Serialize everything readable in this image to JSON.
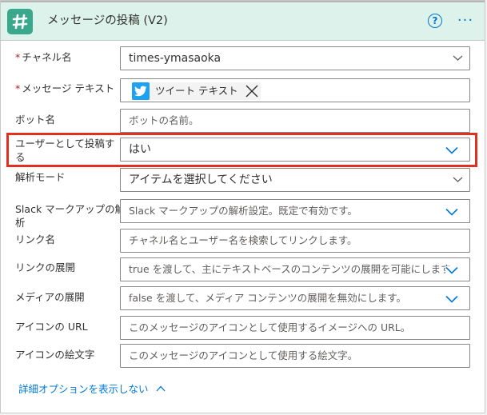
{
  "header": {
    "title": "メッセージの投稿 (V2)",
    "help_glyph": "?",
    "more_glyph": "···",
    "icon": "slack-logo",
    "accent_color": "#ddf2ea"
  },
  "fields": [
    {
      "label": "チャネル名",
      "required": true,
      "value": "times-ymasaoka",
      "kind": "dropdown"
    },
    {
      "label": "メッセージ テキスト",
      "required": true,
      "token": "ツイート テキスト",
      "token_icon": "twitter-icon",
      "kind": "token"
    },
    {
      "label": "ボット名",
      "required": false,
      "placeholder": "ボットの名前。",
      "kind": "text"
    },
    {
      "label_line1": "ユーザーとして投稿す",
      "label_line2": "る",
      "required": false,
      "value": "はい",
      "kind": "dropdown",
      "highlighted": true
    },
    {
      "label": "解析モード",
      "required": false,
      "value": "アイテムを選択してください",
      "kind": "dropdown"
    },
    {
      "label_line1": "Slack マークアップの解",
      "label_line2": "析",
      "required": false,
      "placeholder": "Slack マークアップの解析設定。既定で有効です。",
      "kind": "dropdown"
    },
    {
      "label": "リンク名",
      "required": false,
      "placeholder": "チャネル名とユーザー名を検索してリンクします。",
      "kind": "text"
    },
    {
      "label": "リンクの展開",
      "required": false,
      "placeholder": "true を渡して、主にテキストベースのコンテンツの展開を可能にします。",
      "kind": "dropdown"
    },
    {
      "label": "メディアの展開",
      "required": false,
      "placeholder": "false を渡して、メディア コンテンツの展開を無効にします。",
      "kind": "dropdown"
    },
    {
      "label": "アイコンの URL",
      "required": false,
      "placeholder": "このメッセージのアイコンとして使用するイメージへの URL。",
      "kind": "text"
    },
    {
      "label": "アイコンの絵文字",
      "required": false,
      "placeholder": "このメッセージのアイコンとして使用する絵文字。",
      "kind": "text"
    }
  ],
  "footer": {
    "hide_advanced_label": "詳細オプションを表示しない"
  },
  "colors": {
    "link": "#0078d4",
    "highlight_border": "#e0301e",
    "required_star": "#a4262c"
  }
}
